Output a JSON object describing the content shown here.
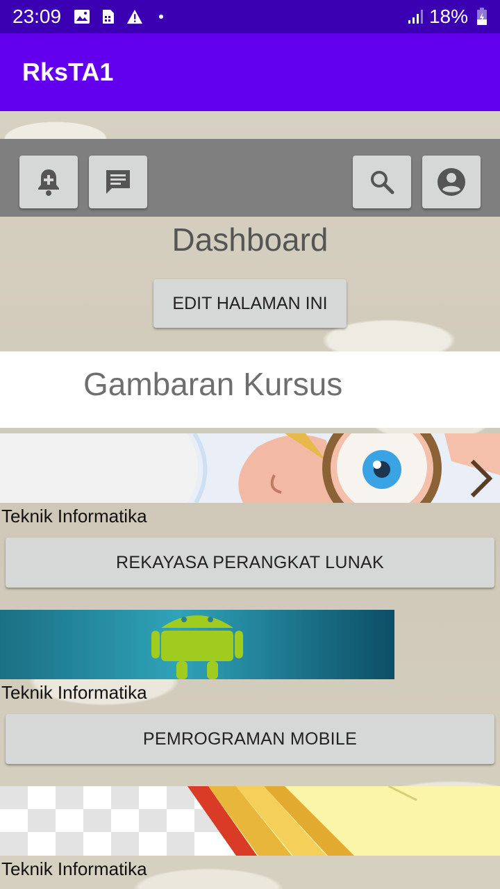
{
  "status_bar": {
    "time": "23:09",
    "battery": "18%",
    "icons": [
      "image-icon",
      "sim-card-icon",
      "warning-icon",
      "dot-icon",
      "signal-icon",
      "battery-icon"
    ]
  },
  "app_bar": {
    "title": "RksTA1"
  },
  "toolbar": {
    "buttons": [
      "add-alert-icon",
      "message-icon",
      "search-icon",
      "account-icon"
    ]
  },
  "dashboard": {
    "title": "Dashboard",
    "edit_label": "EDIT HALAMAN INI"
  },
  "courses_section": {
    "title": "Gambaran Kursus"
  },
  "courses": [
    {
      "category": "Teknik Informatika",
      "name": "REKAYASA PERANGKAT LUNAK"
    },
    {
      "category": "Teknik Informatika",
      "name": "PEMROGRAMAN MOBILE"
    },
    {
      "category": "Teknik Informatika",
      "name": ""
    }
  ],
  "colors": {
    "status_bar": "#3a00b2",
    "app_bar": "#6200ee",
    "toolbar": "#7f7f7f",
    "button": "#d6d7d7"
  }
}
